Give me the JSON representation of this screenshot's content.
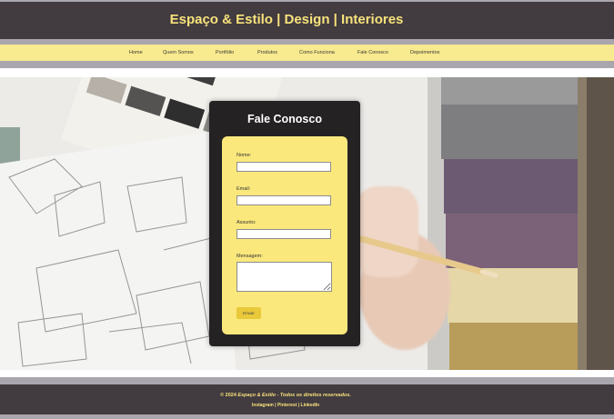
{
  "header": {
    "title": "Espaço & Estilo | Design | Interiores"
  },
  "nav": {
    "items": [
      {
        "label": "Home"
      },
      {
        "label": "Quem Somos"
      },
      {
        "label": "Portfólio"
      },
      {
        "label": "Produtos"
      },
      {
        "label": "Como Funciona"
      },
      {
        "label": "Fale Conosco"
      },
      {
        "label": "Depoimentos"
      }
    ]
  },
  "contact": {
    "title": "Fale Conosco",
    "name_label": "Nome:",
    "email_label": "Email:",
    "subject_label": "Assunto:",
    "message_label": "Mensagem:",
    "submit_label": "Enviar"
  },
  "footer": {
    "copyright_prefix": "© 2024 ",
    "copyright_brand": "Espaço & Estilo - Todos os direitos reservados.",
    "links": "Instagram | Pinterest | LinkedIn"
  },
  "colors": {
    "header_bg": "#423b40",
    "accent_yellow": "#f7e27b",
    "nav_bg": "#f8ea8e",
    "card_bg": "#252223",
    "form_bg": "#fbe87c",
    "button_bg": "#e9c93a"
  }
}
